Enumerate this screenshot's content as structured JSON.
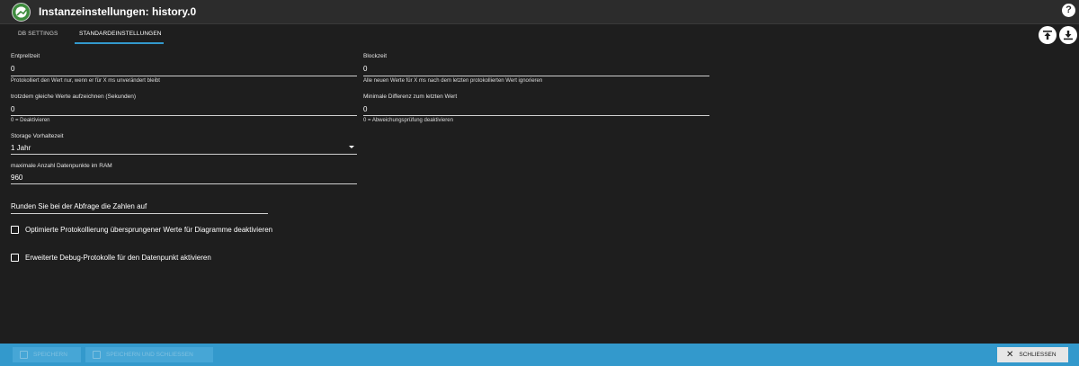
{
  "header": {
    "title": "Instanzeinstellungen: history.0",
    "help_label": "?"
  },
  "tabs": [
    {
      "label": "DB SETTINGS",
      "active": false
    },
    {
      "label": "STANDARDEINSTELLUNGEN",
      "active": true
    }
  ],
  "fields": {
    "entprellzeit": {
      "label": "Entprellzeit",
      "value": "0",
      "help": "Protokolliert den Wert nur, wenn er für X ms unverändert bleibt"
    },
    "blockzeit": {
      "label": "Blockzeit",
      "value": "0",
      "help": "Alle neuen Werte für X ms nach dem letzten protokollierten Wert ignorieren"
    },
    "gleiche_werte": {
      "label": "trotzdem gleiche Werte aufzeichnen (Sekunden)",
      "value": "0",
      "help": "0 = Deaktivieren"
    },
    "min_diff": {
      "label": "Minimale Differenz zum letzten Wert",
      "value": "0",
      "help": "0 = Abweichungsprüfung deaktivieren"
    },
    "storage": {
      "label": "Storage Vorhaltezeit",
      "value": "1 Jahr"
    },
    "max_ram": {
      "label": "maximale Anzahl Datenpunkte im RAM",
      "value": "960"
    },
    "runden": {
      "placeholder": "Runden Sie bei der Abfrage die Zahlen auf"
    }
  },
  "checkboxes": [
    {
      "label": "Optimierte Protokollierung übersprungener Werte für Diagramme deaktivieren",
      "checked": false
    },
    {
      "label": "Erweiterte Debug-Protokolle für den Datenpunkt aktivieren",
      "checked": false
    }
  ],
  "footer": {
    "save_label": "SPEICHERN",
    "save_close_label": "SPEICHERN UND SCHLIESSEN",
    "close_label": "SCHLIESSEN"
  },
  "colors": {
    "accent": "#3399cc",
    "background": "#1e1e1e",
    "header": "#2c2c2c"
  },
  "icons": [
    "app-logo-icon",
    "help-icon",
    "upload-icon",
    "download-icon",
    "save-icon",
    "close-icon",
    "chevron-down-icon"
  ]
}
